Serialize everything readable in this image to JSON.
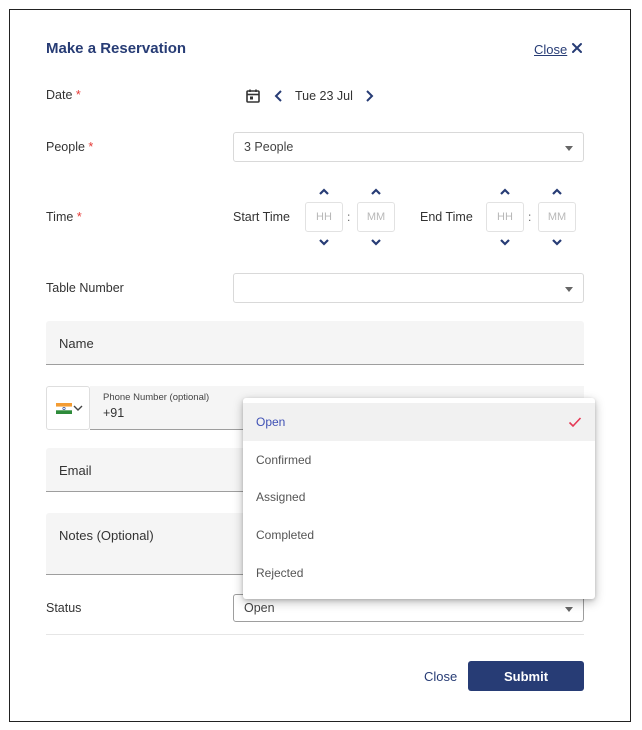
{
  "dialog": {
    "title": "Make a Reservation",
    "close_link": "Close"
  },
  "date": {
    "label": "Date",
    "required_mark": "*",
    "value": "Tue 23 Jul"
  },
  "people": {
    "label": "People",
    "required_mark": "*",
    "value": "3 People"
  },
  "time": {
    "label": "Time",
    "required_mark": "*",
    "start_label": "Start Time",
    "end_label": "End Time",
    "hour_placeholder": "HH",
    "minute_placeholder": "MM",
    "separator": ":"
  },
  "table_number": {
    "label": "Table Number",
    "value": ""
  },
  "name": {
    "placeholder": "Name"
  },
  "phone": {
    "label": "Phone Number (optional)",
    "value": "+91",
    "country_flag": "flag-india-icon"
  },
  "email": {
    "placeholder": "Email"
  },
  "notes": {
    "placeholder": "Notes (Optional)"
  },
  "status": {
    "label": "Status",
    "value": "Open",
    "options": [
      "Open",
      "Confirmed",
      "Assigned",
      "Completed",
      "Rejected"
    ],
    "selected_index": 0
  },
  "footer": {
    "close_label": "Close",
    "submit_label": "Submit"
  },
  "colors": {
    "primary": "#273c75",
    "required": "#e53935",
    "check": "#e53955",
    "selected_option_text": "#3f51b5"
  }
}
